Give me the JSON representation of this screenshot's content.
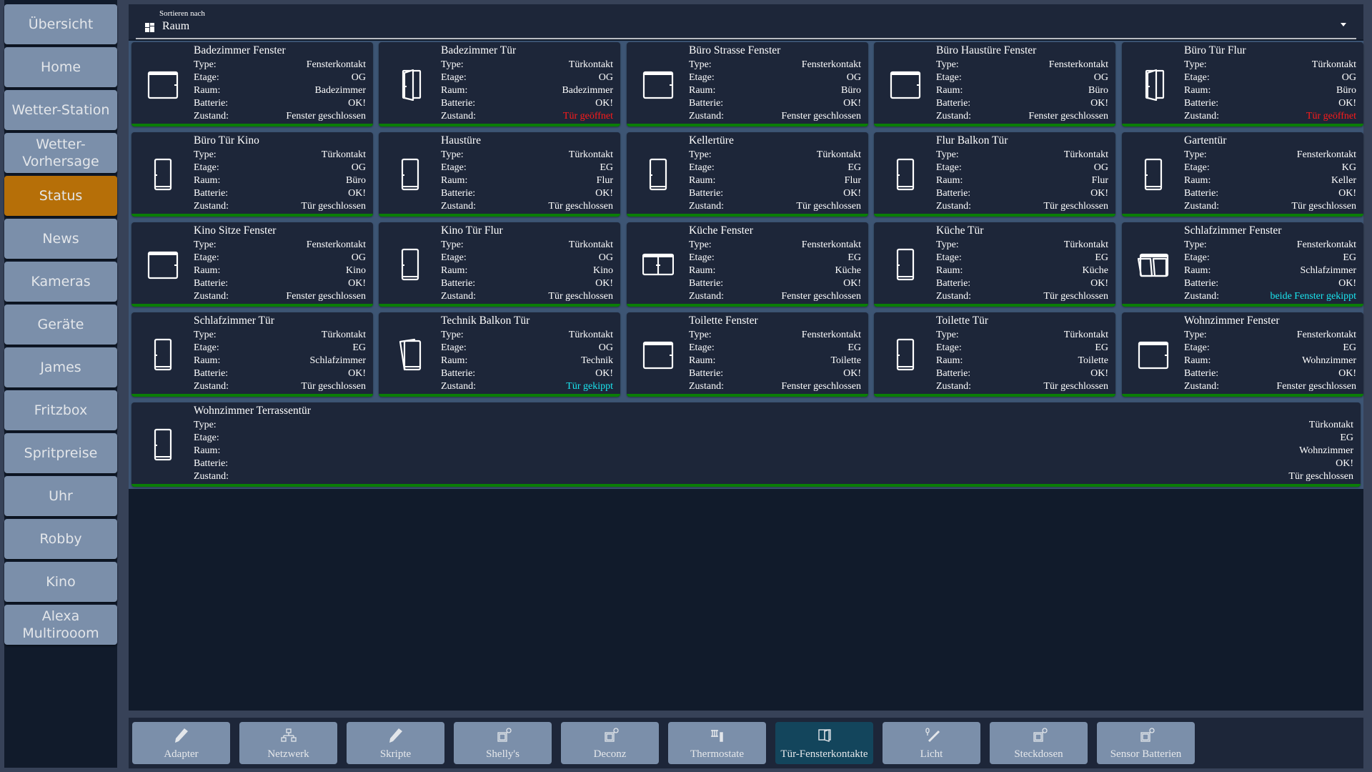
{
  "sidebar": {
    "items": [
      {
        "label": "Übersicht",
        "active": false
      },
      {
        "label": "Home",
        "active": false
      },
      {
        "label": "Wetter-Station",
        "active": false
      },
      {
        "label": "Wetter-\nVorhersage",
        "active": false
      },
      {
        "label": "Status",
        "active": true
      },
      {
        "label": "News",
        "active": false
      },
      {
        "label": "Kameras",
        "active": false
      },
      {
        "label": "Geräte",
        "active": false
      },
      {
        "label": "James",
        "active": false
      },
      {
        "label": "Fritzbox",
        "active": false
      },
      {
        "label": "Spritpreise",
        "active": false
      },
      {
        "label": "Uhr",
        "active": false
      },
      {
        "label": "Robby",
        "active": false
      },
      {
        "label": "Kino",
        "active": false
      },
      {
        "label": "Alexa\nMultirooom",
        "active": false
      }
    ]
  },
  "sort": {
    "label": "Sortieren nach",
    "value": "Raum",
    "icon": "grid-icon"
  },
  "field_labels": {
    "type": "Type:",
    "etage": "Etage:",
    "raum": "Raum:",
    "batterie": "Batterie:",
    "zustand": "Zustand:"
  },
  "colors": {
    "ok_bar": "#0a7d06",
    "state_open": "#ff1a1a",
    "state_tilted": "#1ae6f0",
    "state_normal": "#ffffff",
    "active_nav": "#b66f08",
    "active_toolbar": "#13455c"
  },
  "cards": [
    {
      "title": "Badezimmer Fenster",
      "icon": "window-icon",
      "type": "Fensterkontakt",
      "etage": "OG",
      "raum": "Badezimmer",
      "batterie": "OK!",
      "zustand": "Fenster geschlossen",
      "state": "normal"
    },
    {
      "title": "Badezimmer Tür",
      "icon": "door-open-icon",
      "type": "Türkontakt",
      "etage": "OG",
      "raum": "Badezimmer",
      "batterie": "OK!",
      "zustand": "Tür geöffnet",
      "state": "open"
    },
    {
      "title": "Büro Strasse Fenster",
      "icon": "window-icon",
      "type": "Fensterkontakt",
      "etage": "OG",
      "raum": "Büro",
      "batterie": "OK!",
      "zustand": "Fenster geschlossen",
      "state": "normal"
    },
    {
      "title": "Büro Haustüre Fenster",
      "icon": "window-icon",
      "type": "Fensterkontakt",
      "etage": "OG",
      "raum": "Büro",
      "batterie": "OK!",
      "zustand": "Fenster geschlossen",
      "state": "normal"
    },
    {
      "title": "Büro Tür Flur",
      "icon": "door-open-icon",
      "type": "Türkontakt",
      "etage": "OG",
      "raum": "Büro",
      "batterie": "OK!",
      "zustand": "Tür geöffnet",
      "state": "open"
    },
    {
      "title": "Büro Tür Kino",
      "icon": "door-closed-icon",
      "type": "Türkontakt",
      "etage": "OG",
      "raum": "Büro",
      "batterie": "OK!",
      "zustand": "Tür geschlossen",
      "state": "normal"
    },
    {
      "title": "Haustüre",
      "icon": "door-closed-icon",
      "type": "Türkontakt",
      "etage": "EG",
      "raum": "Flur",
      "batterie": "OK!",
      "zustand": "Tür geschlossen",
      "state": "normal"
    },
    {
      "title": "Kellertüre",
      "icon": "door-closed-icon",
      "type": "Türkontakt",
      "etage": "EG",
      "raum": "Flur",
      "batterie": "OK!",
      "zustand": "Tür geschlossen",
      "state": "normal"
    },
    {
      "title": "Flur Balkon Tür",
      "icon": "door-closed-icon",
      "type": "Türkontakt",
      "etage": "OG",
      "raum": "Flur",
      "batterie": "OK!",
      "zustand": "Tür geschlossen",
      "state": "normal"
    },
    {
      "title": "Gartentür",
      "icon": "door-closed-icon",
      "type": "Fensterkontakt",
      "etage": "KG",
      "raum": "Keller",
      "batterie": "OK!",
      "zustand": "Tür geschlossen",
      "state": "normal"
    },
    {
      "title": "Kino Sitze Fenster",
      "icon": "window-icon",
      "type": "Fensterkontakt",
      "etage": "OG",
      "raum": "Kino",
      "batterie": "OK!",
      "zustand": "Fenster geschlossen",
      "state": "normal"
    },
    {
      "title": "Kino Tür Flur",
      "icon": "door-closed-icon",
      "type": "Türkontakt",
      "etage": "OG",
      "raum": "Kino",
      "batterie": "OK!",
      "zustand": "Tür geschlossen",
      "state": "normal"
    },
    {
      "title": "Küche Fenster",
      "icon": "double-window-icon",
      "type": "Fensterkontakt",
      "etage": "EG",
      "raum": "Küche",
      "batterie": "OK!",
      "zustand": "Fenster geschlossen",
      "state": "normal"
    },
    {
      "title": "Küche Tür",
      "icon": "door-closed-icon",
      "type": "Türkontakt",
      "etage": "EG",
      "raum": "Küche",
      "batterie": "OK!",
      "zustand": "Tür geschlossen",
      "state": "normal"
    },
    {
      "title": "Schlafzimmer Fenster",
      "icon": "double-window-tilted-icon",
      "type": "Fensterkontakt",
      "etage": "EG",
      "raum": "Schlafzimmer",
      "batterie": "OK!",
      "zustand": "beide Fenster gekippt",
      "state": "tilted"
    },
    {
      "title": "Schlafzimmer Tür",
      "icon": "door-closed-icon",
      "type": "Türkontakt",
      "etage": "EG",
      "raum": "Schlafzimmer",
      "batterie": "OK!",
      "zustand": "Tür geschlossen",
      "state": "normal"
    },
    {
      "title": "Technik Balkon Tür",
      "icon": "door-tilted-icon",
      "type": "Türkontakt",
      "etage": "OG",
      "raum": "Technik",
      "batterie": "OK!",
      "zustand": "Tür gekippt",
      "state": "tilted"
    },
    {
      "title": "Toilette Fenster",
      "icon": "window-icon",
      "type": "Fensterkontakt",
      "etage": "EG",
      "raum": "Toilette",
      "batterie": "OK!",
      "zustand": "Fenster geschlossen",
      "state": "normal"
    },
    {
      "title": "Toilette Tür",
      "icon": "door-closed-icon",
      "type": "Türkontakt",
      "etage": "EG",
      "raum": "Toilette",
      "batterie": "OK!",
      "zustand": "Tür geschlossen",
      "state": "normal"
    },
    {
      "title": "Wohnzimmer Fenster",
      "icon": "window-icon",
      "type": "Fensterkontakt",
      "etage": "EG",
      "raum": "Wohnzimmer",
      "batterie": "OK!",
      "zustand": "Fenster geschlossen",
      "state": "normal"
    },
    {
      "title": "Wohnzimmer Terrassentür",
      "icon": "door-closed-icon",
      "type": "Türkontakt",
      "etage": "EG",
      "raum": "Wohnzimmer",
      "batterie": "OK!",
      "zustand": "Tür geschlossen",
      "state": "normal"
    }
  ],
  "toolbar": {
    "buttons": [
      {
        "label": "Adapter",
        "icon": "pencil-icon",
        "active": false
      },
      {
        "label": "Netzwerk",
        "icon": "network-icon",
        "active": false
      },
      {
        "label": "Skripte",
        "icon": "pencil-icon",
        "active": false
      },
      {
        "label": "Shelly's",
        "icon": "socket-icon",
        "active": false
      },
      {
        "label": "Deconz",
        "icon": "socket-icon",
        "active": false
      },
      {
        "label": "Thermostate",
        "icon": "radiator-icon",
        "active": false
      },
      {
        "label": "Tür-Fensterkontakte",
        "icon": "door-window-icon",
        "active": true
      },
      {
        "label": "Licht",
        "icon": "light-strip-icon",
        "active": false
      },
      {
        "label": "Steckdosen",
        "icon": "socket-icon",
        "active": false
      },
      {
        "label": "Sensor Batterien",
        "icon": "socket-icon",
        "active": false
      }
    ]
  }
}
